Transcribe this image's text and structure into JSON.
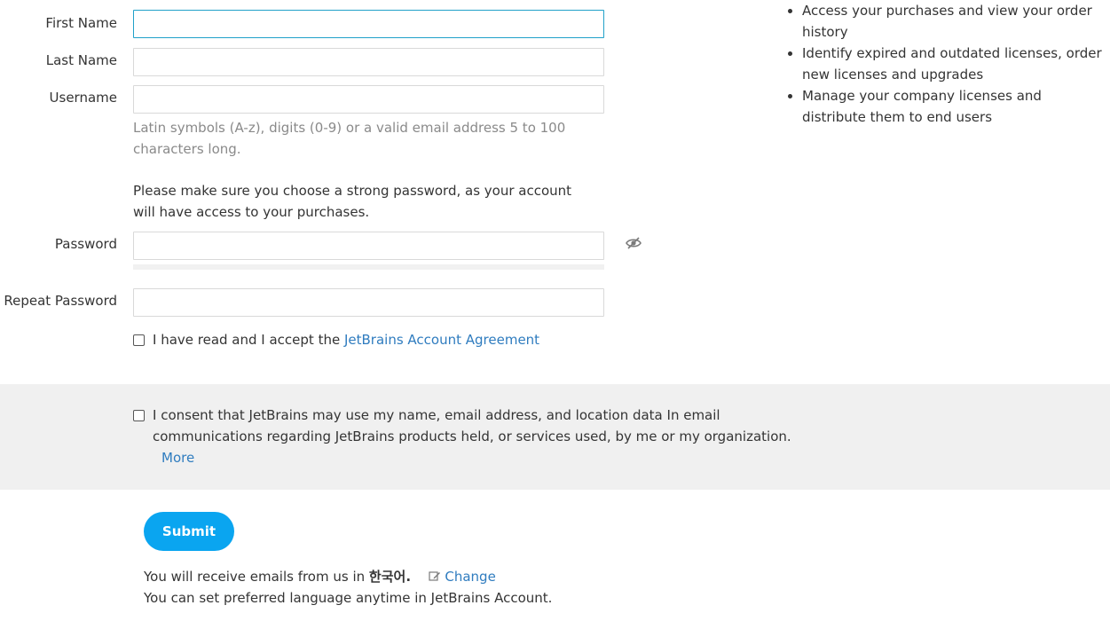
{
  "form": {
    "first_name_label": "First Name",
    "first_name_value": "",
    "last_name_label": "Last Name",
    "last_name_value": "",
    "username_label": "Username",
    "username_value": "",
    "username_hint": "Latin symbols (A-z), digits (0-9) or a valid email address 5 to 100 characters long.",
    "password_note": "Please make sure you choose a strong password, as your account will have access to your purchases.",
    "password_label": "Password",
    "password_value": "",
    "repeat_password_label": "Repeat Password",
    "repeat_password_value": "",
    "agreement_text": "I have read and I accept the",
    "agreement_link": "JetBrains Account Agreement",
    "agreement_checked": false
  },
  "consent": {
    "text": "I consent that JetBrains may use my name, email address, and location data In email communications regarding JetBrains products held, or services used, by me or my organization.",
    "more_link": "More",
    "checked": false
  },
  "submit": {
    "label": "Submit"
  },
  "footer": {
    "language_prefix": "You will receive emails from us in",
    "language_name": "한국어.",
    "change_link": "Change",
    "language_note": "You can set preferred language anytime in JetBrains Account."
  },
  "benefits": [
    "Access your purchases and view your order history",
    "Identify expired and outdated licenses, order new licenses and upgrades",
    "Manage your company licenses and distribute them to end users"
  ],
  "colors": {
    "link": "#2f7cbf",
    "submit_bg": "#0aa5f0",
    "focus_border": "#21a1c9",
    "consent_band": "#f0f0f0"
  },
  "icons": {
    "password_toggle": "eye-slash-icon",
    "change_language": "edit-icon"
  }
}
